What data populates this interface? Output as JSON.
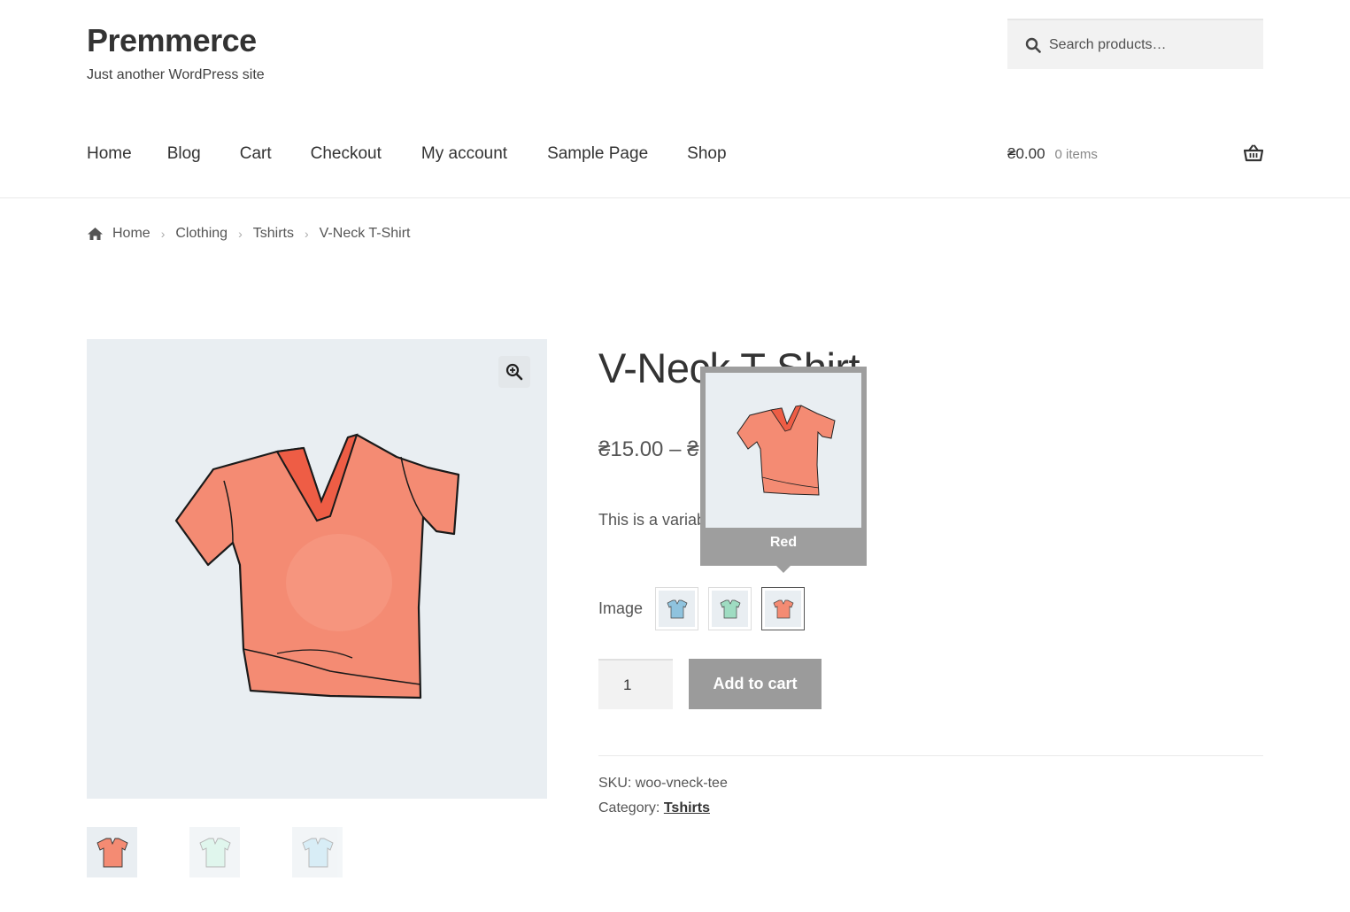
{
  "site": {
    "title": "Premmerce",
    "description": "Just another WordPress site"
  },
  "search": {
    "placeholder": "Search products…"
  },
  "nav": {
    "items": [
      "Home",
      "Blog",
      "Cart",
      "Checkout",
      "My account",
      "Sample Page",
      "Shop"
    ]
  },
  "cart": {
    "amount": "₴0.00",
    "count": "0 items"
  },
  "breadcrumb": {
    "home": "Home",
    "clothing": "Clothing",
    "tshirts": "Tshirts",
    "current": "V-Neck T-Shirt",
    "separator": "›"
  },
  "product": {
    "title": "V-Neck T-Shirt",
    "price": "₴15.00 – ₴",
    "short_description": "This is a variab",
    "variation_label": "Image",
    "quantity": "1",
    "add_to_cart_label": "Add to cart",
    "sku_label": "SKU:",
    "sku": "woo-vneck-tee",
    "category_label": "Category:",
    "category": "Tshirts"
  },
  "swatches": [
    {
      "name": "Blue",
      "color": "#8fc3de"
    },
    {
      "name": "Green",
      "color": "#9fdcc2"
    },
    {
      "name": "Red",
      "color": "#f48b73"
    }
  ],
  "tooltip": {
    "label": "Red"
  },
  "colors": {
    "tee_red": "#f48b73",
    "tee_green": "#c7efdf",
    "tee_blue": "#b9dff0",
    "image_bg": "#e9eef2",
    "button_gray": "#9b9b9b"
  },
  "icons": {
    "search": "search-icon",
    "cart": "basket-icon",
    "home": "home-icon",
    "zoom": "zoom-in-icon"
  }
}
